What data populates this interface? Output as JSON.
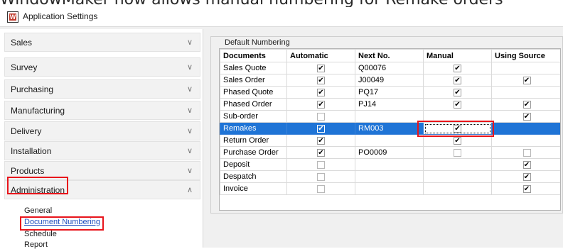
{
  "caption": "WindowMaker now allows manual numbering for Remake orders",
  "window": {
    "title": "Application Settings"
  },
  "sidebar": {
    "items": [
      {
        "label": "Sales"
      },
      {
        "label": "Survey"
      },
      {
        "label": "Purchasing"
      },
      {
        "label": "Manufacturing"
      },
      {
        "label": "Delivery"
      },
      {
        "label": "Installation"
      },
      {
        "label": "Products"
      },
      {
        "label": "Administration"
      }
    ],
    "subitems": [
      {
        "label": "General"
      },
      {
        "label": "Document Numbering"
      },
      {
        "label": "Schedule"
      },
      {
        "label": "Report"
      }
    ]
  },
  "group": {
    "label": "Default Numbering"
  },
  "table": {
    "columns": [
      "Documents",
      "Automatic",
      "Next No.",
      "Manual",
      "Using Source"
    ],
    "rows": [
      {
        "doc": "Sales Quote",
        "auto": true,
        "next": "Q00076",
        "manual": true,
        "source": null
      },
      {
        "doc": "Sales Order",
        "auto": true,
        "next": "J00049",
        "manual": true,
        "source": true
      },
      {
        "doc": "Phased Quote",
        "auto": true,
        "next": "PQ17",
        "manual": true,
        "source": null
      },
      {
        "doc": "Phased Order",
        "auto": true,
        "next": "PJ14",
        "manual": true,
        "source": true
      },
      {
        "doc": "Sub-order",
        "auto": false,
        "next": "",
        "manual": null,
        "source": true
      },
      {
        "doc": "Remakes",
        "auto": true,
        "next": "RM003",
        "manual": true,
        "source": null
      },
      {
        "doc": "Return Order",
        "auto": true,
        "next": "",
        "manual": true,
        "source": null
      },
      {
        "doc": "Purchase Order",
        "auto": true,
        "next": "PO0009",
        "manual": false,
        "source": false
      },
      {
        "doc": "Deposit",
        "auto": false,
        "next": "",
        "manual": null,
        "source": true
      },
      {
        "doc": "Despatch",
        "auto": false,
        "next": "",
        "manual": null,
        "source": true
      },
      {
        "doc": "Invoice",
        "auto": false,
        "next": "",
        "manual": null,
        "source": true
      }
    ],
    "selected_row": "Remakes"
  },
  "icons": {
    "app": "windowmaker-logo-icon",
    "expand": "chevron-down-icon",
    "collapse": "chevron-up-icon",
    "check": "checkbox-icon"
  },
  "colors": {
    "selection": "#1f74d6",
    "highlight_box": "#e8141b",
    "link": "#1f4fbf"
  }
}
